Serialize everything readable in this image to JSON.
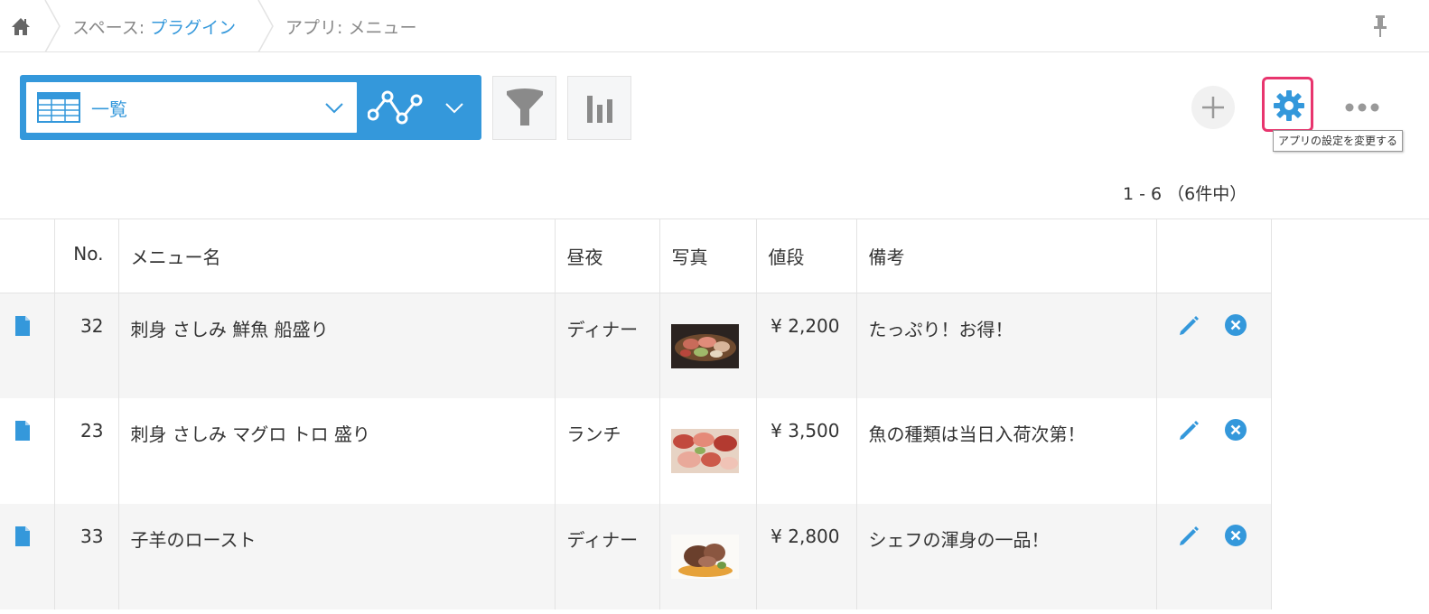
{
  "breadcrumb": {
    "space_prefix": "スペース: ",
    "space_name": "プラグイン",
    "app_prefix": "アプリ: ",
    "app_name": "メニュー"
  },
  "toolbar": {
    "view_label": "一覧",
    "settings_tooltip": "アプリの設定を変更する"
  },
  "pager": {
    "text": "1 - 6 （6件中）"
  },
  "table": {
    "headers": {
      "no": "No.",
      "name": "メニュー名",
      "time": "昼夜",
      "photo": "写真",
      "price": "値段",
      "note": "備考"
    },
    "rows": [
      {
        "no": "32",
        "name": "刺身 さしみ 鮮魚 船盛り",
        "time": "ディナー",
        "price": "¥ 2,200",
        "note": "たっぷり！お得！"
      },
      {
        "no": "23",
        "name": "刺身 さしみ マグロ トロ 盛り",
        "time": "ランチ",
        "price": "¥ 3,500",
        "note": "魚の種類は当日入荷次第！"
      },
      {
        "no": "33",
        "name": "子羊のロースト",
        "time": "ディナー",
        "price": "¥ 2,800",
        "note": "シェフの渾身の一品！"
      }
    ]
  },
  "colors": {
    "accent": "#3498db",
    "highlight": "#e8356e"
  }
}
